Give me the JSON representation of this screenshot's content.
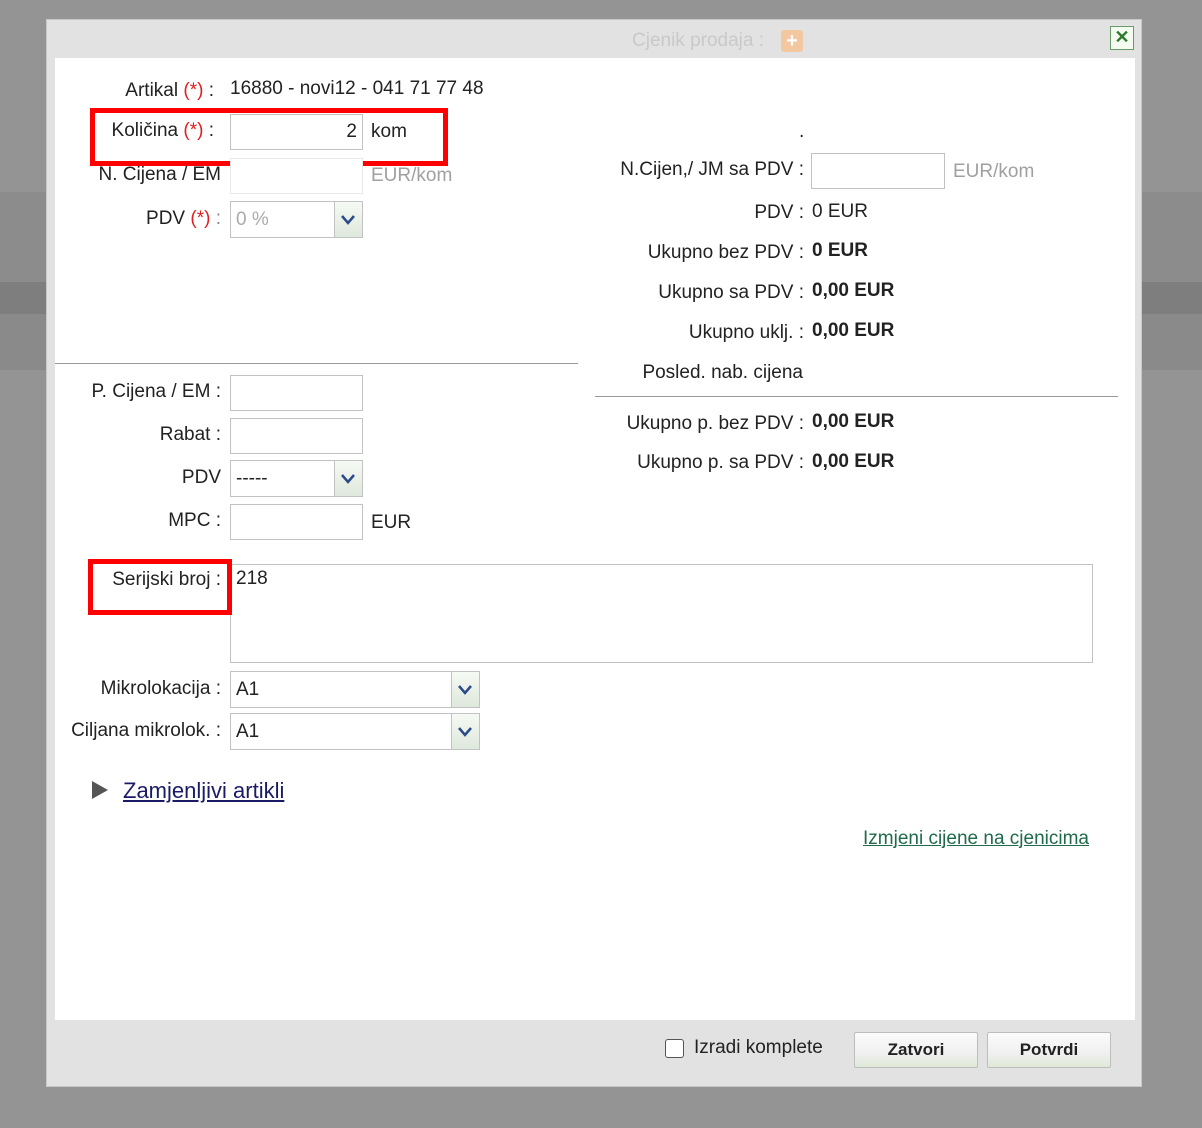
{
  "dialog": {
    "title": "Cjenik prodaja :",
    "title_icon": "plus-icon",
    "close_icon": "close-icon"
  },
  "left": {
    "artikal_label": "Artikal",
    "required_mark": "(*)",
    "colon": ":",
    "artikal_value": "16880 - novi12 - 041 71 77 48",
    "kolicina_label": "Količina",
    "kolicina_value": "2",
    "kolicina_unit": "kom",
    "ncijena_label": "N. Cijena / EM",
    "ncijena_value": "",
    "ncijena_unit": "EUR/kom",
    "pdv_label": "PDV",
    "pdv_value": "0 %",
    "pcijena_label": "P. Cijena / EM :",
    "pcijena_value": "",
    "rabat_label": "Rabat :",
    "rabat_value": "",
    "pdv2_label": "PDV",
    "pdv2_value": "-----",
    "mpc_label": "MPC :",
    "mpc_value": "",
    "mpc_unit": "EUR",
    "serijski_label": "Serijski broj :",
    "serijski_value": "218",
    "mikrolokacija_label": "Mikrolokacija :",
    "mikrolokacija_value": "A1",
    "ciljana_label": "Ciljana mikrolok. :",
    "ciljana_value": "A1",
    "zamjenljivi_label": "Zamjenljivi artikli",
    "izmjeni_link": "Izmjeni cijene na cjenicima"
  },
  "right": {
    "dot": ".",
    "ncijen_label": "N.Cijen,/ JM sa PDV :",
    "ncijen_value": "",
    "ncijen_unit": "EUR/kom",
    "pdv_label": "PDV :",
    "pdv_value": "0 EUR",
    "ukupno_bez_label": "Ukupno bez PDV :",
    "ukupno_bez_value": "0 EUR",
    "ukupno_sa_label": "Ukupno sa PDV :",
    "ukupno_sa_value": "0,00 EUR",
    "ukupno_uklj_label": "Ukupno uklj. :",
    "ukupno_uklj_value": "0,00 EUR",
    "posled_label": "Posled. nab. cijena",
    "ukupno_p_bez_label": "Ukupno p. bez PDV :",
    "ukupno_p_bez_value": "0,00 EUR",
    "ukupno_p_sa_label": "Ukupno p. sa PDV :",
    "ukupno_p_sa_value": "0,00 EUR"
  },
  "footer": {
    "izradi_label": "Izradi komplete",
    "izradi_checked": false,
    "zatvori_label": "Zatvori",
    "potvrdi_label": "Potvrdi"
  },
  "colors": {
    "highlight": "#ff0000",
    "required": "#e02020",
    "link_left": "#1a1a66",
    "link_right": "#1f6a4a"
  }
}
